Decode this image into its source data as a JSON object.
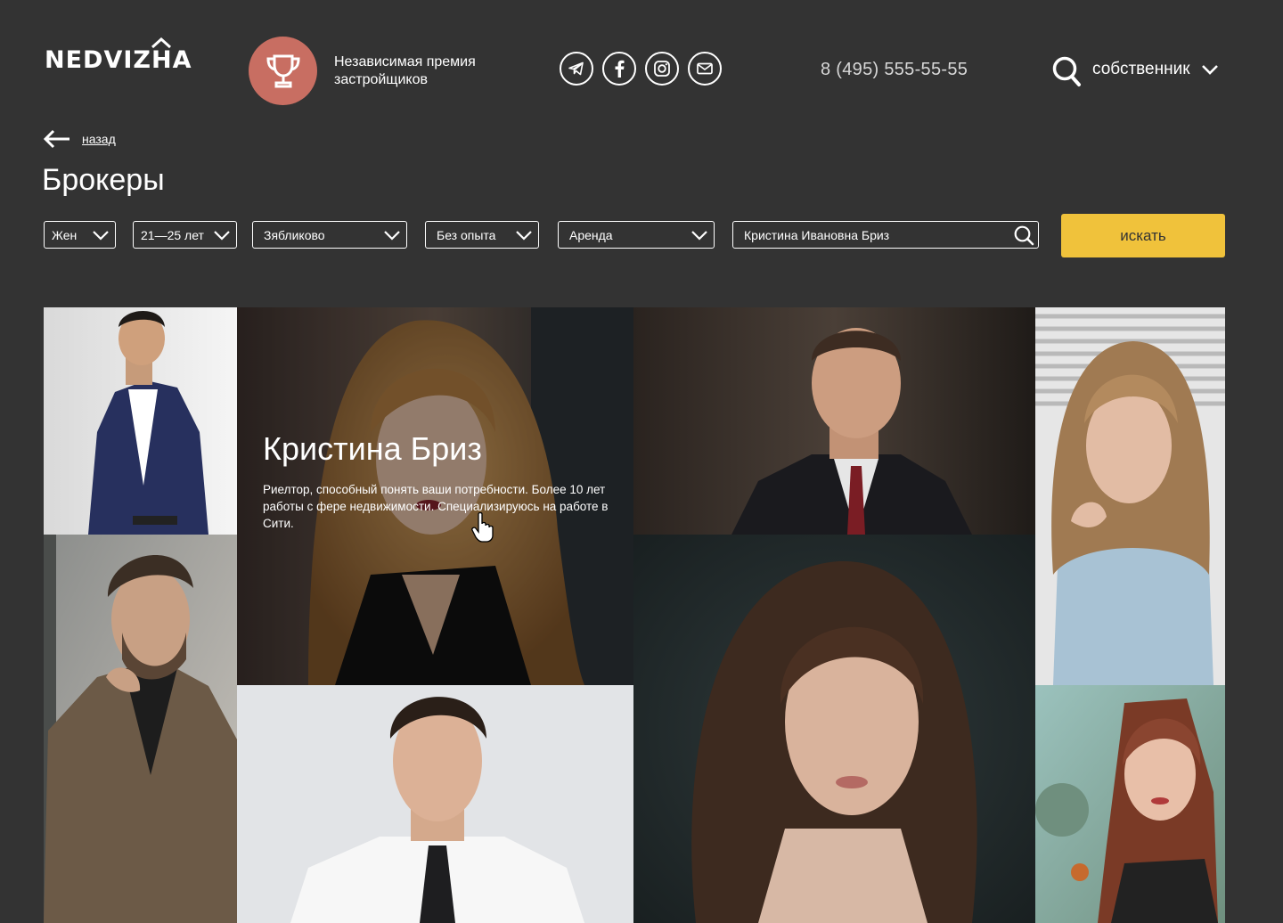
{
  "header": {
    "logo": "NEDVIZHA",
    "award_text": "Независимая премия застройщиков",
    "social": [
      "telegram-icon",
      "facebook-icon",
      "instagram-icon",
      "mail-icon"
    ],
    "phone": "8 (495) 555-55-55",
    "role": "собственник"
  },
  "nav": {
    "back_label": "назад"
  },
  "page": {
    "title": "Брокеры"
  },
  "filters": {
    "gender": "Жен",
    "age": "21—25 лет",
    "district": "Зябликово",
    "experience": "Без опыта",
    "deal_type": "Аренда",
    "search_value": "Кристина Ивановна Бриз",
    "search_button": "искать"
  },
  "featured": {
    "name": "Кристина Бриз",
    "description": "Риелтор, способный понять ваши потребности.  Более 10 лет работы с фере недвижимости. Специализируюсь на работе в Сити."
  },
  "colors": {
    "background": "#333333",
    "accent": "#f0c23b",
    "award": "#c86e62"
  }
}
